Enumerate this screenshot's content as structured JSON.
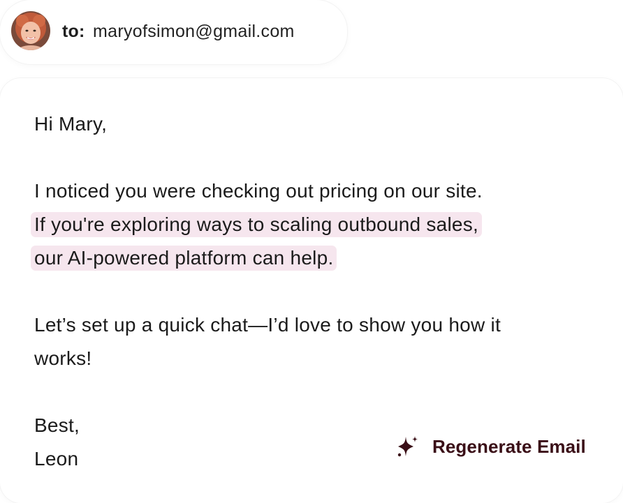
{
  "recipient": {
    "to_label": "to:",
    "email": "maryofsimon@gmail.com",
    "avatar_icon": "user-avatar"
  },
  "email": {
    "greeting": "Hi Mary,",
    "paragraph1_line1": "I noticed you were checking out pricing on our site.",
    "paragraph1_line2": "If you're exploring ways to scaling outbound sales,",
    "paragraph1_line3": "our AI-powered platform can help.",
    "paragraph2_line1": "Let’s set up a quick chat—I’d love to show you how it",
    "paragraph2_line2": "works!",
    "signoff": "Best,",
    "signature": "Leon"
  },
  "actions": {
    "regenerate_label": "Regenerate Email",
    "regenerate_icon": "sparkle-icon"
  },
  "colors": {
    "highlight": "#f6e6ee",
    "accent": "#3a0f17"
  }
}
